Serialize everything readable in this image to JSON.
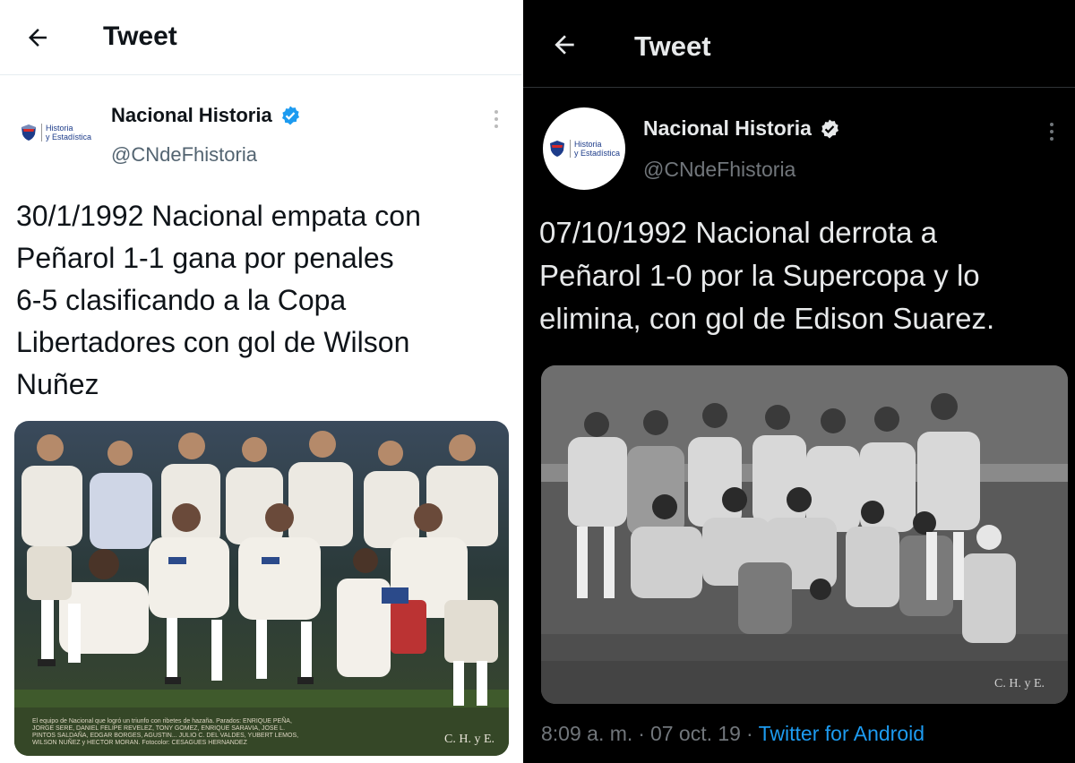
{
  "left": {
    "header": {
      "title": "Tweet"
    },
    "author": {
      "name": "Nacional Historia",
      "handle": "@CNdeFhistoria",
      "logo_line1": "Historia",
      "logo_line2": "y Estadística"
    },
    "tweet": {
      "text": "30/1/1992 Nacional empata con\nPeñarol 1-1 gana por penales\n6-5 clasificando a la Copa\nLibertadores con gol de Wilson\nNuñez"
    },
    "photo": {
      "watermark": "C. H. y E.",
      "caption": "El equipo de Nacional que logró un triunfo con ribetes de hazaña. Parados: ENRIQUE PEÑA, JORGE SERE, DANIEL FELIPE REVELEZ, TONY GOMEZ, ENRIQUE SARAVIA, JOSE L. PINTOS SALDAÑA, EDGAR BORGES, AGUSTIN... JULIO C. DEL VALDES, YUBERT LEMOS, WILSON NUÑEZ y HECTOR MORAN. Fotocolor: CESAGUES HERNANDEZ"
    },
    "colors": {
      "verified": "#1d9bf0",
      "bg": "#ffffff",
      "text": "#0f1419",
      "muted": "#536471"
    }
  },
  "right": {
    "header": {
      "title": "Tweet"
    },
    "author": {
      "name": "Nacional Historia",
      "handle": "@CNdeFhistoria",
      "logo_line1": "Historia",
      "logo_line2": "y Estadística"
    },
    "tweet": {
      "text": "07/10/1992 Nacional derrota a\nPeñarol 1-0 por la Supercopa y lo\nelimina, con gol de Edison Suarez."
    },
    "photo": {
      "watermark": "C. H. y E."
    },
    "meta": {
      "time": "8:09 a. m.",
      "sep1": "·",
      "date": "07 oct. 19",
      "sep2": "·",
      "source": "Twitter for Android"
    },
    "colors": {
      "verified": "#e7e9ea",
      "bg": "#000000",
      "text": "#e7e9ea",
      "muted": "#71767b",
      "link": "#1d9bf0"
    }
  }
}
